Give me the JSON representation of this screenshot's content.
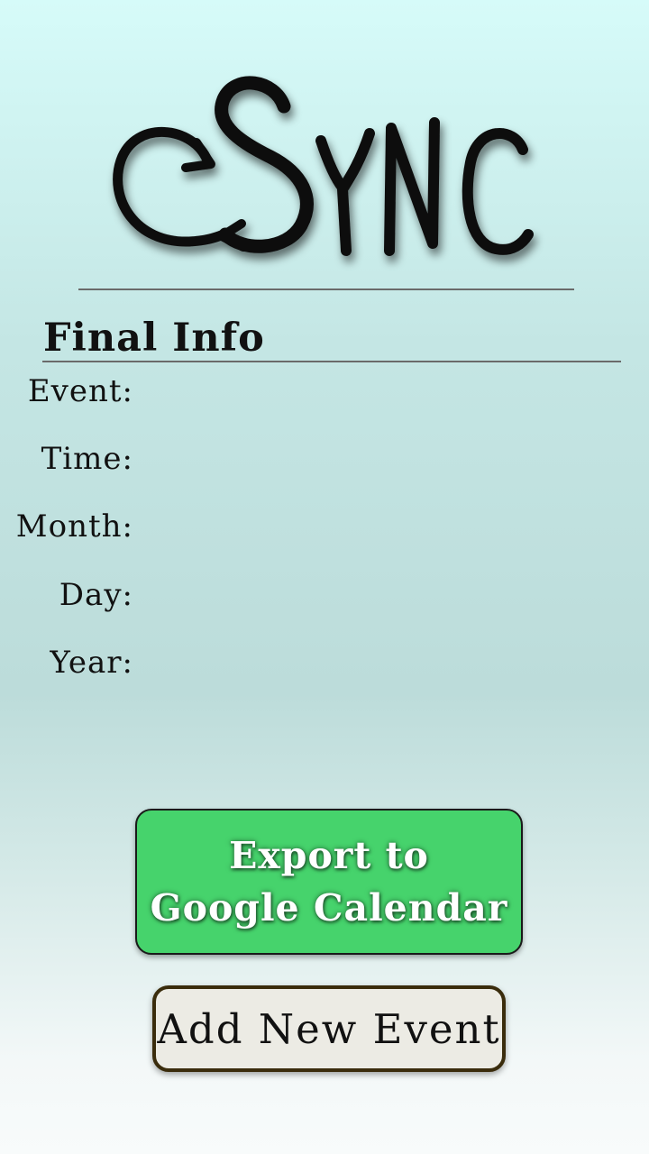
{
  "app": {
    "logo_text": "cSync"
  },
  "section": {
    "title": "Final Info"
  },
  "fields": [
    {
      "label": "Event:",
      "value": ""
    },
    {
      "label": "Time:",
      "value": ""
    },
    {
      "label": "Month:",
      "value": ""
    },
    {
      "label": "Day:",
      "value": ""
    },
    {
      "label": "Year:",
      "value": ""
    }
  ],
  "actions": {
    "export_label": "Export to\nGoogle Calendar",
    "add_label": "Add New Event"
  },
  "colors": {
    "export_button": "#46d36c",
    "add_button": "#ecebe4",
    "add_button_border": "#3a2c0c"
  }
}
